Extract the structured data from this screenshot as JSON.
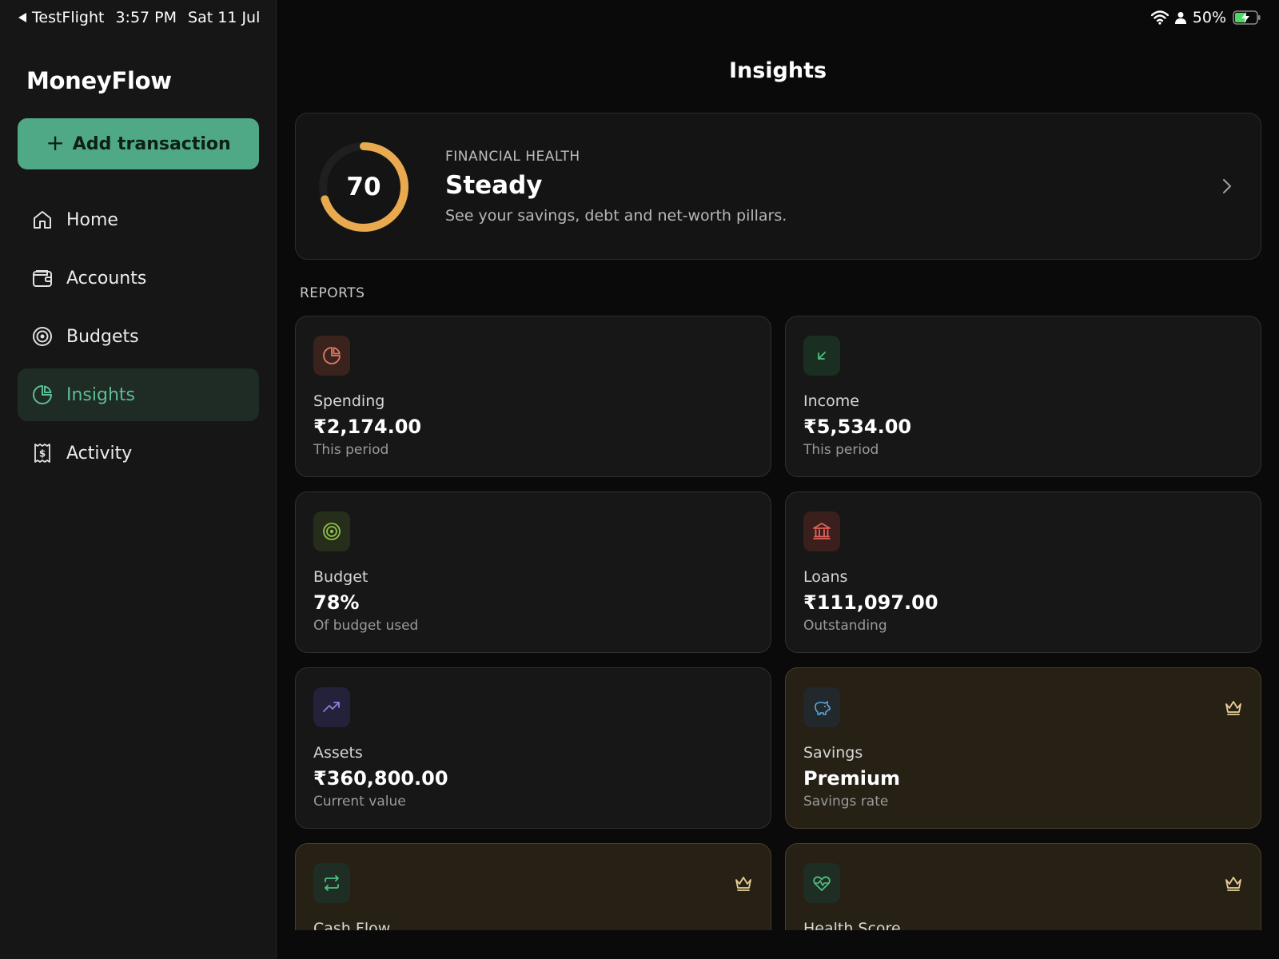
{
  "status_bar": {
    "back_app": "TestFlight",
    "time": "3:57 PM",
    "date": "Sat 11 Jul",
    "battery": "50%"
  },
  "sidebar": {
    "app_title": "MoneyFlow",
    "add_button": "Add transaction",
    "items": [
      {
        "label": "Home",
        "icon": "home-icon"
      },
      {
        "label": "Accounts",
        "icon": "wallet-icon"
      },
      {
        "label": "Budgets",
        "icon": "target-icon"
      },
      {
        "label": "Insights",
        "icon": "pie-chart-icon",
        "active": true
      },
      {
        "label": "Activity",
        "icon": "receipt-icon"
      }
    ]
  },
  "main": {
    "title": "Insights",
    "financial_health": {
      "score": "70",
      "score_fraction": 0.7,
      "label": "FINANCIAL HEALTH",
      "status": "Steady",
      "description": "See your savings, debt and net-worth pillars."
    },
    "reports_label": "REPORTS",
    "cards": [
      {
        "title": "Spending",
        "value": "₹2,174.00",
        "sub": "This period",
        "icon": "pie-chart-icon",
        "color": "#e07a63"
      },
      {
        "title": "Income",
        "value": "₹5,534.00",
        "sub": "This period",
        "icon": "arrow-down-left-icon",
        "color": "#4fbf83"
      },
      {
        "title": "Budget",
        "value": "78%",
        "sub": "Of budget used",
        "icon": "target-icon",
        "color": "#8fbf4a"
      },
      {
        "title": "Loans",
        "value": "₹111,097.00",
        "sub": "Outstanding",
        "icon": "bank-icon",
        "color": "#e0635a"
      },
      {
        "title": "Assets",
        "value": "₹360,800.00",
        "sub": "Current value",
        "icon": "trending-up-icon",
        "color": "#8a7fe0"
      },
      {
        "title": "Savings",
        "value": "Premium",
        "sub": "Savings rate",
        "icon": "piggy-bank-icon",
        "color": "#5aa8e0",
        "premium": true
      },
      {
        "title": "Cash Flow",
        "value": "",
        "sub": "",
        "icon": "repeat-icon",
        "color": "#4fbf83",
        "premium": true
      },
      {
        "title": "Health Score",
        "value": "",
        "sub": "",
        "icon": "heart-pulse-icon",
        "color": "#4fbf83",
        "premium": true
      }
    ]
  }
}
